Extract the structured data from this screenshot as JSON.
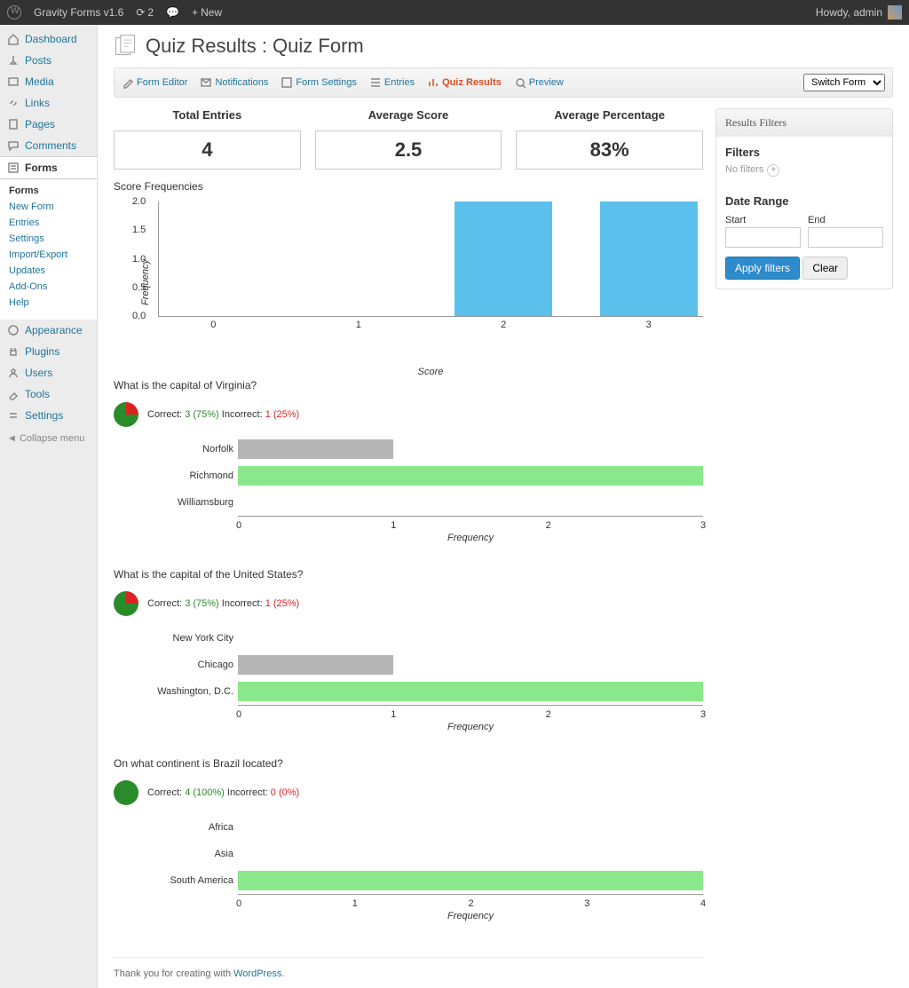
{
  "topbar": {
    "site": "Gravity Forms v1.6",
    "updates": "2",
    "new": "New",
    "howdy": "Howdy, admin"
  },
  "sidebar": {
    "items": [
      {
        "label": "Dashboard"
      },
      {
        "label": "Posts"
      },
      {
        "label": "Media"
      },
      {
        "label": "Links"
      },
      {
        "label": "Pages"
      },
      {
        "label": "Comments"
      },
      {
        "label": "Forms"
      },
      {
        "label": "Appearance"
      },
      {
        "label": "Plugins"
      },
      {
        "label": "Users"
      },
      {
        "label": "Tools"
      },
      {
        "label": "Settings"
      }
    ],
    "sub": [
      "Forms",
      "New Form",
      "Entries",
      "Settings",
      "Import/Export",
      "Updates",
      "Add-Ons",
      "Help"
    ],
    "collapse": "Collapse menu"
  },
  "page": {
    "title": "Quiz Results : Quiz Form"
  },
  "toolbar": {
    "editor": "Form Editor",
    "notif": "Notifications",
    "settings": "Form Settings",
    "entries": "Entries",
    "quiz": "Quiz Results",
    "preview": "Preview",
    "switch": "Switch Form"
  },
  "stats": {
    "total_label": "Total Entries",
    "total": "4",
    "avg_label": "Average Score",
    "avg": "2.5",
    "pct_label": "Average Percentage",
    "pct": "83%"
  },
  "score_chart": {
    "title": "Score Frequencies",
    "ylabel": "Frequency",
    "xlabel": "Score"
  },
  "questions": [
    {
      "title": "What is the capital of Virginia?",
      "correct_label": "Correct:",
      "correct": "3 (75%)",
      "incorrect_label": "Incorrect:",
      "incorrect": "1 (25%)"
    },
    {
      "title": "What is the capital of the United States?",
      "correct_label": "Correct:",
      "correct": "3 (75%)",
      "incorrect_label": "Incorrect:",
      "incorrect": "1 (25%)"
    },
    {
      "title": "On what continent is Brazil located?",
      "correct_label": "Correct:",
      "correct": "4 (100%)",
      "incorrect_label": "Incorrect:",
      "incorrect": "0 (0%)"
    }
  ],
  "freq_label": "Frequency",
  "filters": {
    "hdr": "Results Filters",
    "filters_label": "Filters",
    "none": "No filters",
    "date_range": "Date Range",
    "start": "Start",
    "end": "End",
    "apply": "Apply filters",
    "clear": "Clear"
  },
  "footer": {
    "text": "Thank you for creating with ",
    "link": "WordPress"
  },
  "chart_data": [
    {
      "type": "bar",
      "title": "Score Frequencies",
      "xlabel": "Score",
      "ylabel": "Frequency",
      "categories": [
        0,
        1,
        2,
        3
      ],
      "values": [
        0,
        0,
        2,
        2
      ],
      "ylim": [
        0,
        2
      ]
    },
    {
      "type": "bar",
      "title": "What is the capital of Virginia?",
      "xlabel": "Frequency",
      "categories": [
        "Norfolk",
        "Richmond",
        "Williamsburg"
      ],
      "values": [
        1,
        3,
        0
      ],
      "correct": "Richmond",
      "xlim": [
        0,
        3
      ]
    },
    {
      "type": "bar",
      "title": "What is the capital of the United States?",
      "xlabel": "Frequency",
      "categories": [
        "New York City",
        "Chicago",
        "Washington, D.C."
      ],
      "values": [
        0,
        1,
        3
      ],
      "correct": "Washington, D.C.",
      "xlim": [
        0,
        3
      ]
    },
    {
      "type": "bar",
      "title": "On what continent is Brazil located?",
      "xlabel": "Frequency",
      "categories": [
        "Africa",
        "Asia",
        "South America"
      ],
      "values": [
        0,
        0,
        4
      ],
      "correct": "South America",
      "xlim": [
        0,
        4
      ]
    }
  ]
}
